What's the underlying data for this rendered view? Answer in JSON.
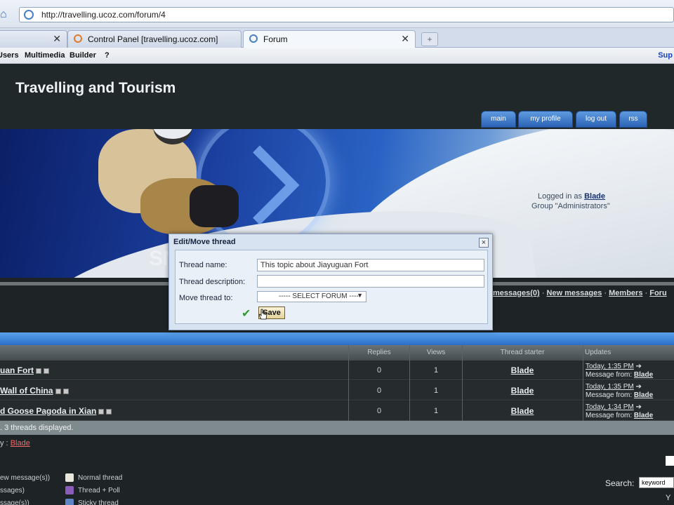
{
  "browser": {
    "url": "http://travelling.ucoz.com/forum/4",
    "tabs": [
      {
        "label": "Control Panel [travelling.ucoz.com]"
      },
      {
        "label": "Forum"
      }
    ],
    "new_tab": "+",
    "close_glyph": "✕"
  },
  "menubar": {
    "items": [
      "Users",
      "Multimedia",
      "Builder",
      "?"
    ],
    "support": "Sup"
  },
  "site": {
    "title": "Travelling and Tourism",
    "nav": [
      "main",
      "my profile",
      "log out",
      "rss"
    ],
    "banner_text": "SN",
    "logged_in_prefix": "Logged in as",
    "user": "Blade",
    "group_text": "Group \"Administrators\""
  },
  "forum_nav": {
    "links": [
      "messages(0)",
      "New messages",
      "Members",
      "Foru"
    ],
    "separator": "·"
  },
  "table": {
    "headers": [
      "Replies",
      "Views",
      "Thread starter",
      "Updates"
    ],
    "rows": [
      {
        "title": "uan Fort",
        "replies": "0",
        "views": "1",
        "starter": "Blade",
        "update_time": "Today, 1:35 PM",
        "update_from_label": "Message from:",
        "update_from": "Blade"
      },
      {
        "title": "Wall of China",
        "replies": "0",
        "views": "1",
        "starter": "Blade",
        "update_time": "Today, 1:35 PM",
        "update_from_label": "Message from:",
        "update_from": "Blade"
      },
      {
        "title": "d Goose Pagoda in Xian",
        "replies": "0",
        "views": "1",
        "starter": "Blade",
        "update_time": "Today, 1:34 PM",
        "update_from_label": "Message from:",
        "update_from": "Blade"
      }
    ],
    "threads_displayed": ". 3 threads displayed.",
    "moderators_prefix": "y :",
    "moderator": "Blade"
  },
  "legend": {
    "left": [
      "ew message(s))",
      "ssages)",
      "ssage(s))"
    ],
    "right": [
      "Normal thread",
      "Thread + Poll",
      "Sticky thread"
    ]
  },
  "search": {
    "label": "Search:",
    "value": "keyword",
    "corner_text": "Y"
  },
  "modal": {
    "title": "Edit/Move thread",
    "close": "×",
    "name_label": "Thread name:",
    "name_value": "This topic about Jiayuguan Fort",
    "desc_label": "Thread description:",
    "desc_value": "",
    "move_label": "Move thread to:",
    "select_value": "----- SELECT FORUM -----",
    "select_arrow": "▼",
    "save_label": "Save",
    "check_glyph": "✔"
  },
  "icons": {
    "home": "⌂"
  },
  "colors": {
    "accent_blue": "#2a6fc8",
    "header_bg": "#21282a",
    "moderator_link": "#f06a6a"
  }
}
